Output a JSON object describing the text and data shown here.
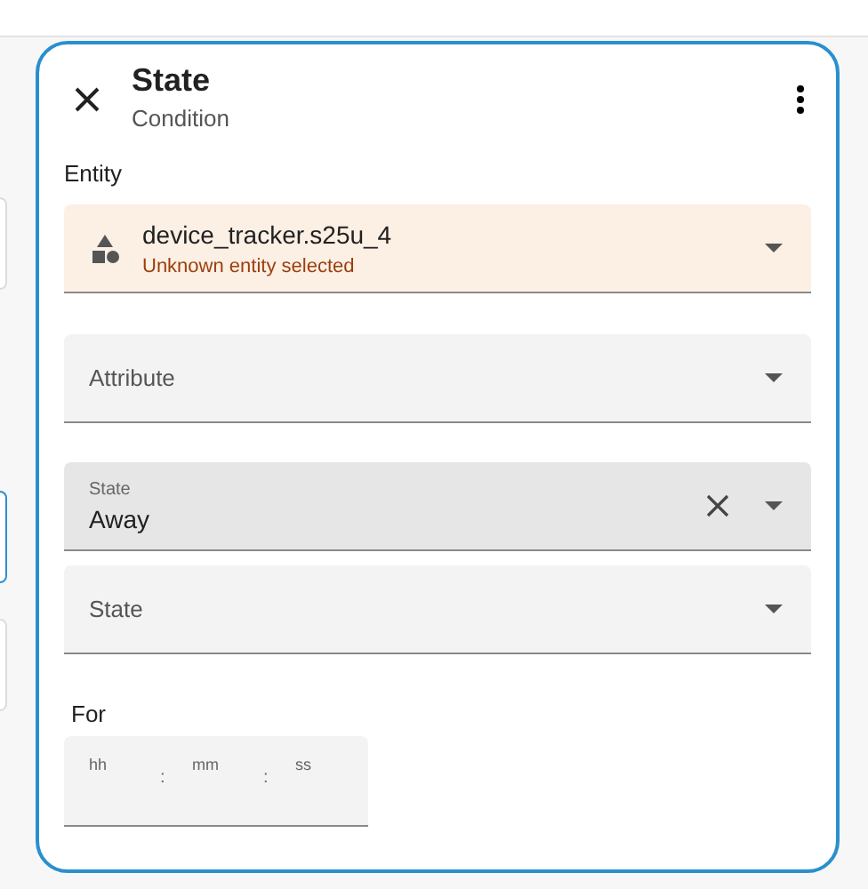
{
  "dialog": {
    "title": "State",
    "subtitle": "Condition"
  },
  "entity": {
    "label": "Entity",
    "value": "device_tracker.s25u_4",
    "error": "Unknown entity selected"
  },
  "fields": [
    {
      "kind": "select",
      "placeholder": "Attribute",
      "highlighted": false
    },
    {
      "kind": "select",
      "label": "State",
      "value": "Away",
      "clearable": true,
      "highlighted": true
    },
    {
      "kind": "select",
      "placeholder": "State",
      "highlighted": false
    }
  ],
  "duration": {
    "label": "For",
    "parts": [
      {
        "placeholder": "hh",
        "separator": ":"
      },
      {
        "placeholder": "mm",
        "separator": ":"
      },
      {
        "placeholder": "ss"
      }
    ]
  }
}
